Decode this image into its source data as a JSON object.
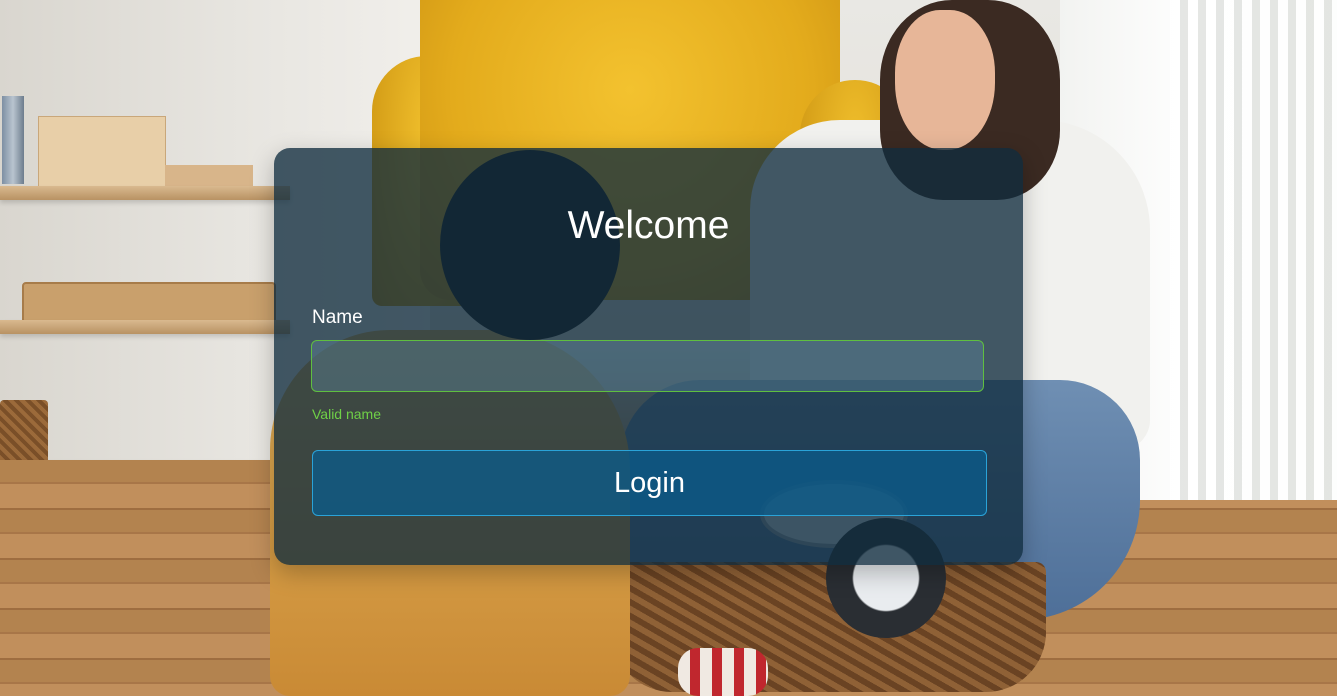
{
  "login_form": {
    "title": "Welcome",
    "name_label": "Name",
    "name_value": "",
    "name_validation": "Valid name",
    "login_label": "Login"
  },
  "colors": {
    "card_background": "#102c3e",
    "valid_green": "#6fd047",
    "button_border": "#2aa3d8",
    "button_background": "#0a5c8c"
  }
}
